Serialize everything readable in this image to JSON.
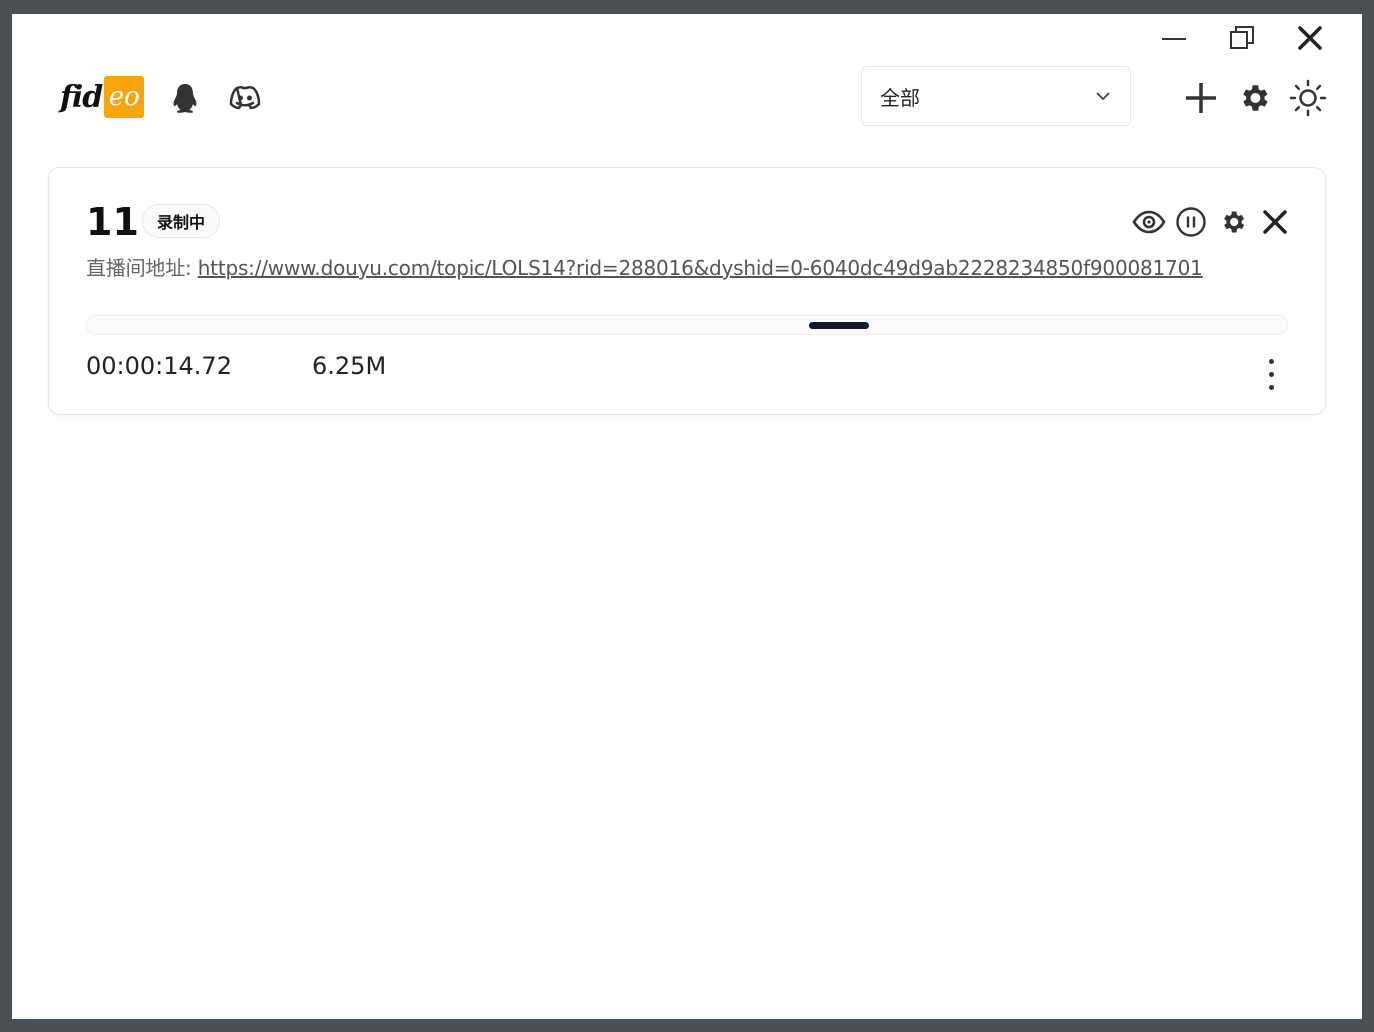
{
  "window": {
    "controls": [
      "minimize-icon",
      "restore-icon",
      "close-icon"
    ]
  },
  "header": {
    "logo": {
      "part1": "fid",
      "part2": "eo",
      "accent_color": "#f7a40f"
    },
    "social_icons": [
      "qq-icon",
      "discord-icon"
    ],
    "filter": {
      "selected": "全部",
      "icon": "chevron-down-icon"
    },
    "actions": [
      "plus-icon",
      "gear-icon",
      "sun-icon"
    ]
  },
  "tasks": [
    {
      "title": "11",
      "status": "录制中",
      "url_label": "直播间地址: ",
      "url": "https://www.douyu.com/topic/LOLS14?rid=288016&dyshid=0-6040dc49d9ab2228234850f900081701",
      "actions": [
        "eye-icon",
        "pause-icon",
        "gear-icon",
        "close-icon"
      ],
      "duration": "00:00:14.72",
      "size": "6.25M",
      "progress_indeterminate": true,
      "progress_color": "#111827"
    }
  ]
}
